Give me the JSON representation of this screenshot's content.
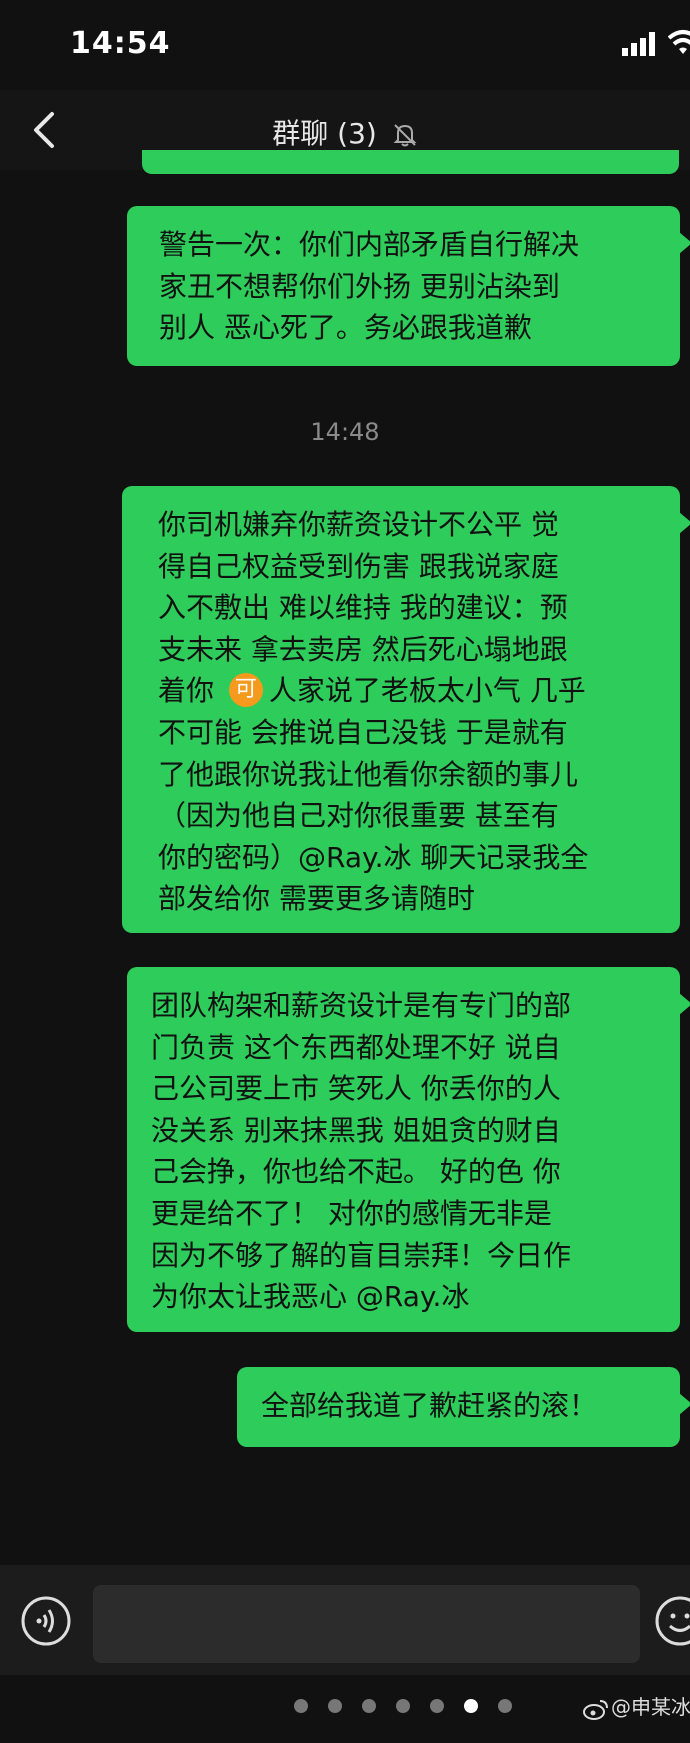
{
  "status_bar": {
    "time": "14:54"
  },
  "nav": {
    "title": "群聊 (3)"
  },
  "messages": {
    "m1": [
      "警告一次：你们内部矛盾自行解决",
      "家丑不想帮你们外扬 更别沾染到",
      "别人 恶心死了。务必跟我道歉"
    ],
    "timestamp": "14:48",
    "m2": [
      "你司机嫌弃你薪资设计不公平 觉",
      "得自己权益受到伤害 跟我说家庭",
      "入不敷出 难以维持 我的建议：预",
      "支未来 拿去卖房 然后死心塌地跟"
    ],
    "m2_line5_pre": "着你 ",
    "m2_emoji": "可",
    "m2_line5_post": "人家说了老板太小气 几乎",
    "m2_rest": [
      "不可能 会推说自己没钱 于是就有",
      "了他跟你说我让他看你余额的事儿",
      "（因为他自己对你很重要 甚至有",
      "你的密码）@Ray.冰 聊天记录我全",
      "部发给你 需要更多请随时"
    ],
    "m3": [
      "团队构架和薪资设计是有专门的部",
      "门负责 这个东西都处理不好 说自",
      "己公司要上市 笑死人  你丢你的人",
      "没关系 别来抹黑我 姐姐贪的财自",
      "己会挣，你也给不起。 好的色 你",
      "更是给不了！ 对你的感情无非是",
      "因为不够了解的盲目崇拜！今日作",
      "为你太让我恶心 @Ray.冰"
    ],
    "m4": [
      "全部给我道了歉赶紧的滚！"
    ]
  },
  "watermark": "@申某冰",
  "pager": {
    "count": 7,
    "active": 5
  },
  "colors": {
    "bubble": "#2ecc5a",
    "background": "#111111"
  }
}
